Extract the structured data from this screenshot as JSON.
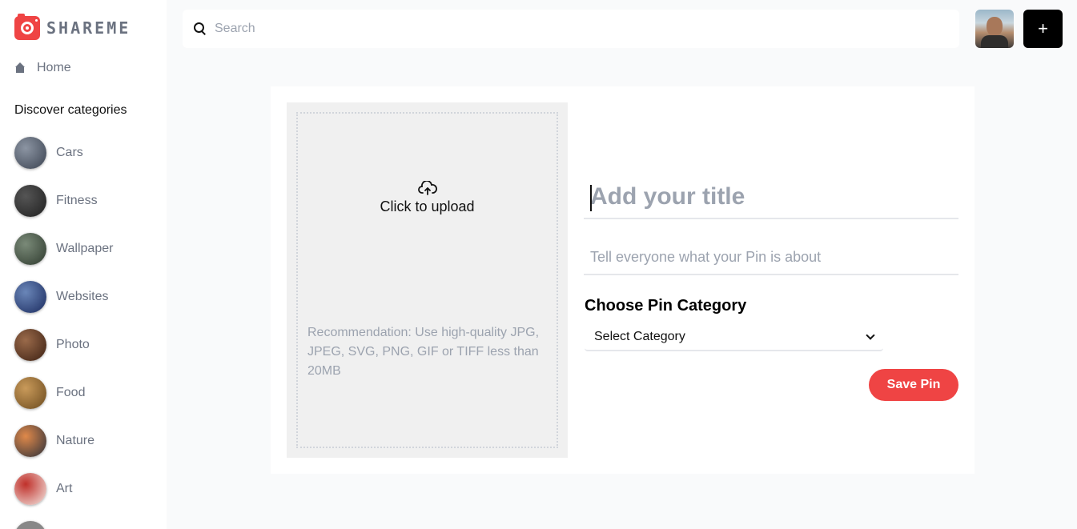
{
  "app": {
    "logo_text": "SHAREME",
    "accent": "#ef4444"
  },
  "sidebar": {
    "home_label": "Home",
    "discover_label": "Discover categories",
    "categories": [
      {
        "label": "Cars",
        "thumb_colors": [
          "#3a4250",
          "#8c95a3"
        ]
      },
      {
        "label": "Fitness",
        "thumb_colors": [
          "#1f1f1f",
          "#555555"
        ]
      },
      {
        "label": "Wallpaper",
        "thumb_colors": [
          "#2e3a2e",
          "#7a8a78"
        ]
      },
      {
        "label": "Websites",
        "thumb_colors": [
          "#1a2a5e",
          "#6a86b8"
        ]
      },
      {
        "label": "Photo",
        "thumb_colors": [
          "#3b1f12",
          "#9a6a4a"
        ]
      },
      {
        "label": "Food",
        "thumb_colors": [
          "#6b4a1e",
          "#c99a5a"
        ]
      },
      {
        "label": "Nature",
        "thumb_colors": [
          "#2a2f3a",
          "#e0894a"
        ]
      },
      {
        "label": "Art",
        "thumb_colors": [
          "#f4e9e4",
          "#c0302a"
        ]
      }
    ]
  },
  "header": {
    "search_placeholder": "Search",
    "add_label": "+"
  },
  "upload": {
    "click_label": "Click to upload",
    "recommendation": "Recommendation: Use high-quality JPG, JPEG, SVG, PNG, GIF or TIFF less than 20MB"
  },
  "form": {
    "title_placeholder": "Add your title",
    "about_placeholder": "Tell everyone what your Pin is about",
    "category_label": "Choose Pin Category",
    "category_selected": "Select Category",
    "save_label": "Save Pin"
  }
}
